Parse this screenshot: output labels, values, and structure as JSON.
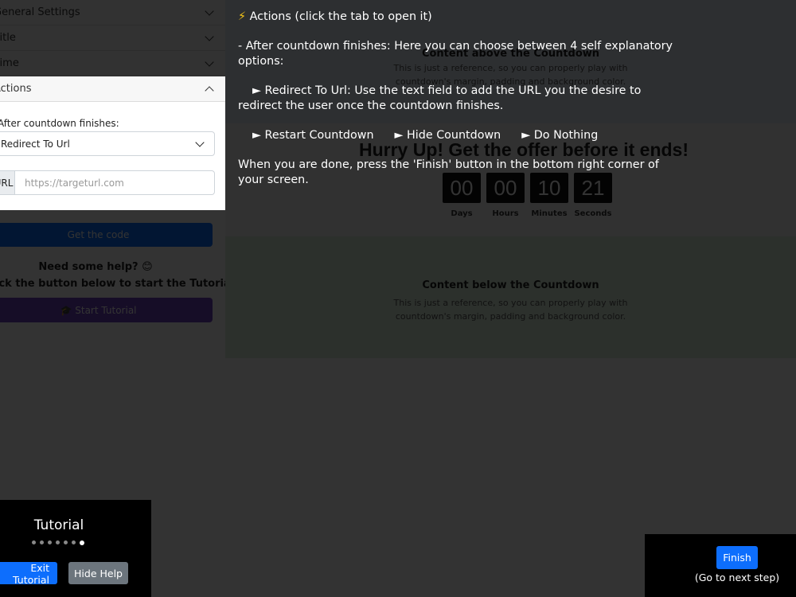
{
  "sidebar": {
    "sections": [
      {
        "label": "General Settings"
      },
      {
        "label": "Title"
      },
      {
        "label": "Time"
      },
      {
        "label": "Actions"
      }
    ],
    "actions": {
      "field_label": "After countdown finishes:",
      "selected_option": "Redirect To Url",
      "url_prefix": "URL",
      "url_placeholder": "https://targeturl.com"
    },
    "get_code_label": "Get the code",
    "help_title": "Need some help? 😊",
    "help_text": "Click the button below to start the Tutorial.",
    "start_tutorial_label": "🎓 Start Tutorial"
  },
  "preview": {
    "top_title": "Content above the Countdown",
    "reference_text_1": "This is just a reference, so you can properly play with",
    "reference_text_2": "countdown's margin, padding and background color.",
    "countdown_heading": "Hurry Up! Get the offer before it ends!",
    "countdown": [
      {
        "value": "00",
        "caption": "Days"
      },
      {
        "value": "00",
        "caption": "Hours"
      },
      {
        "value": "10",
        "caption": "Minutes"
      },
      {
        "value": "21",
        "caption": "Seconds"
      }
    ],
    "bottom_title": "Content below the Countdown"
  },
  "help": {
    "icon": "⚡",
    "title": "Actions (click the tab to open it)",
    "intro": "- After countdown finishes: Here you can choose between 4 self explanatory options:",
    "redirect": "► Redirect To Url: Use the text field to add the URL you the desire to redirect the user once the countdown finishes.",
    "options": [
      "► Restart Countdown",
      "► Hide Countdown",
      "► Do Nothing"
    ],
    "finish_note": "When you are done, press the 'Finish' button in the bottom right corner of your screen."
  },
  "tutorial": {
    "title": "Tutorial",
    "step_total": 7,
    "step_current": 7,
    "exit_label": "Exit Tutorial",
    "hide_label": "Hide Help",
    "finish_label": "Finish",
    "finish_sub": "(Go to next step)"
  },
  "colors": {
    "primary": "#0d6efd",
    "secondary": "#6c757d",
    "purple": "#6f42c1",
    "bolt": "#f5c518"
  }
}
